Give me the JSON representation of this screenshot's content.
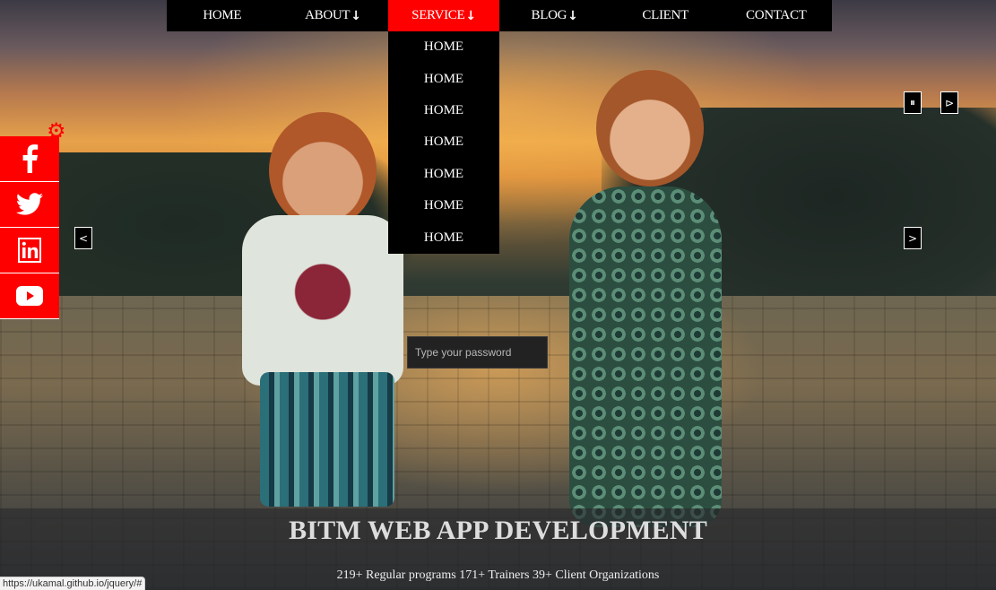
{
  "nav": {
    "items": [
      {
        "label": "HOME",
        "arrow": ""
      },
      {
        "label": "ABOUT",
        "arrow": "↓"
      },
      {
        "label": "SERVICE",
        "arrow": "↓",
        "active": true
      },
      {
        "label": "BLOG",
        "arrow": "↓"
      },
      {
        "label": "CLIENT",
        "arrow": ""
      },
      {
        "label": "CONTACT",
        "arrow": ""
      }
    ],
    "active_color": "#ff0000"
  },
  "dropdown": {
    "items": [
      "HOME",
      "HOME",
      "HOME",
      "HOME",
      "HOME",
      "HOME",
      "HOME"
    ]
  },
  "social": {
    "items": [
      "facebook-icon",
      "twitter-icon",
      "linkedin-icon",
      "youtube-icon"
    ],
    "color": "#ff0000"
  },
  "slider": {
    "pause_label": "⏸",
    "play_label": "⊳",
    "prev_label": "<",
    "next_label": ">"
  },
  "password": {
    "placeholder": "Type your password",
    "value": ""
  },
  "hero": {
    "headline": "BITM WEB APP DEVELOPMENT",
    "stats": "219+ Regular programs 171+ Trainers 39+ Client Organizations"
  },
  "status_bar": {
    "url": "https://ukamal.github.io/jquery/#"
  }
}
